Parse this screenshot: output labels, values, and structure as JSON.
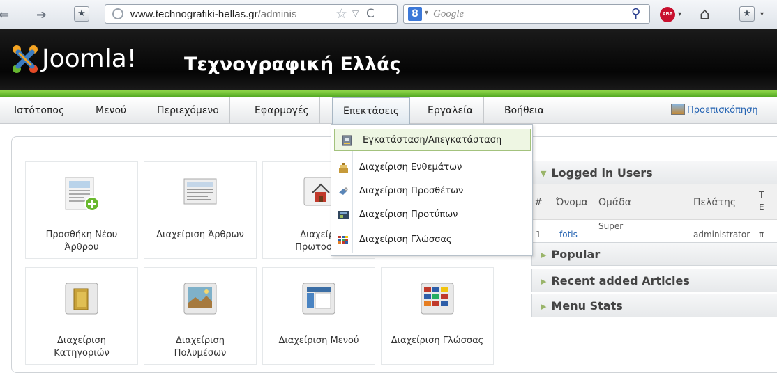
{
  "browser": {
    "url_domain": "www.technografiki-hellas.gr",
    "url_path": "/adminis",
    "search_placeholder": "Google",
    "icons": [
      "back-arrow-icon",
      "forward-arrow-icon",
      "bookmark-icon",
      "globe-icon",
      "star-icon",
      "reload-icon",
      "google-icon",
      "search-icon",
      "adblock-icon",
      "home-icon"
    ]
  },
  "header": {
    "logo_text": "Joomla!",
    "site_title": "Τεχνογραφική Ελλάς",
    "accent_color": "#6ec132"
  },
  "menu": {
    "items": [
      "Ιστότοπος",
      "Μενού",
      "Περιεχόμενο",
      "Εφαρμογές",
      "Επεκτάσεις",
      "Εργαλεία",
      "Βοήθεια"
    ],
    "active": "Επεκτάσεις",
    "preview_label": "Προεπισκόπηση"
  },
  "dropdown": {
    "items": [
      {
        "label": "Εγκατάσταση/Απεγκατάσταση",
        "icon": "install-icon",
        "highlighted": true
      },
      {
        "label": "Διαχείριση Ενθεμάτων",
        "icon": "modules-icon"
      },
      {
        "label": "Διαχείριση Προσθέτων",
        "icon": "plugins-icon"
      },
      {
        "label": "Διαχείριση Προτύπων",
        "icon": "templates-icon"
      },
      {
        "label": "Διαχείριση Γλώσσας",
        "icon": "language-icon"
      }
    ]
  },
  "quick_icons": [
    {
      "line1": "Προσθήκη Νέου",
      "line2": "Άρθρου",
      "icon": "add-article-icon"
    },
    {
      "line1": "Διαχείριση Άρθρων",
      "line2": "",
      "icon": "articles-icon"
    },
    {
      "line1": "Διαχείρι",
      "line2": "Πρωτοσέλ",
      "icon": "frontpage-icon"
    },
    {
      "line1": "Διαχείριση",
      "line2": "Κατηγοριών",
      "icon": "categories-icon"
    },
    {
      "line1": "Διαχείριση",
      "line2": "Πολυμέσων",
      "icon": "media-icon"
    },
    {
      "line1": "Διαχείριση Μενού",
      "line2": "",
      "icon": "menu-manager-icon"
    },
    {
      "line1": "Διαχείριση Γλώσσας",
      "line2": "",
      "icon": "language-manager-icon"
    }
  ],
  "panes": {
    "logged_in": {
      "title": "Logged in Users",
      "columns": [
        "#",
        "Όνομα",
        "Ομάδα",
        "Πελάτης",
        "Τ",
        "Ε"
      ],
      "row": {
        "num": "1",
        "name": "fotis",
        "group": "Super",
        "client": "administrator",
        "extra": "π"
      }
    },
    "others": [
      "Popular",
      "Recent added Articles",
      "Menu Stats"
    ]
  }
}
